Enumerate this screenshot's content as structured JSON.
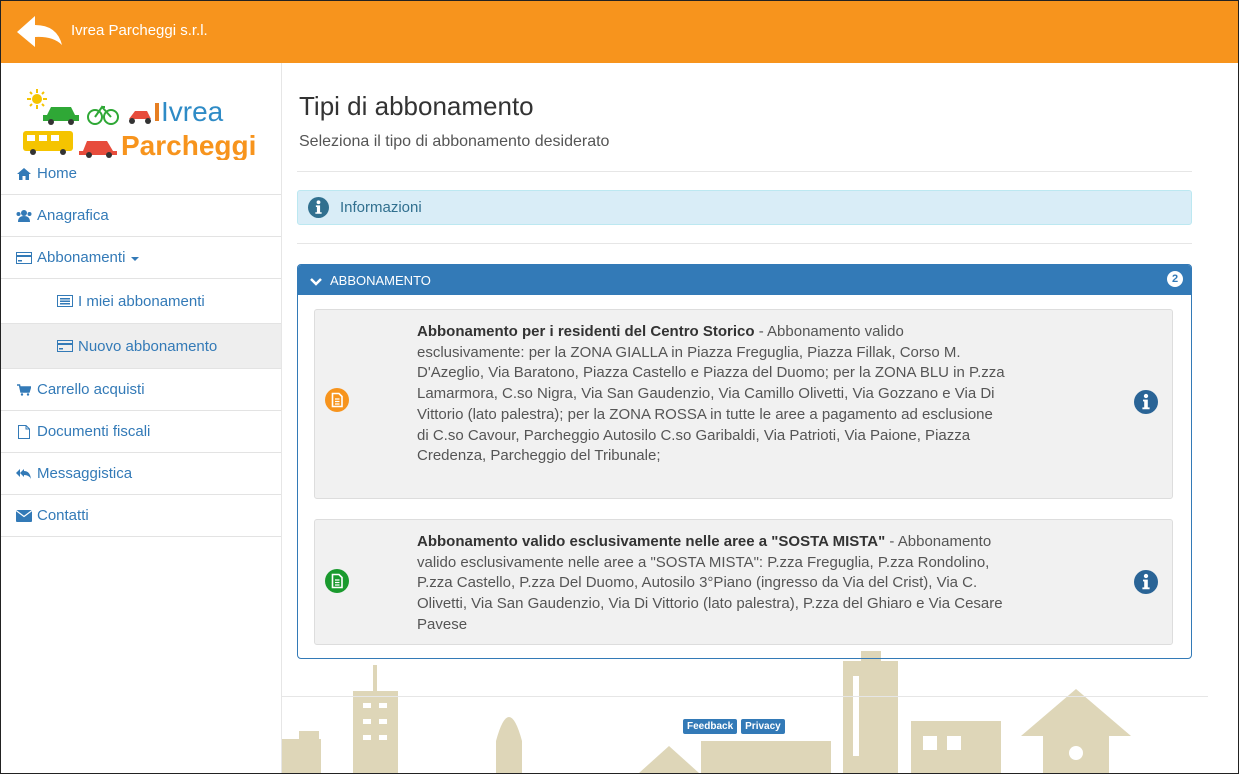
{
  "header": {
    "brand": "Ivrea Parcheggi s.r.l.",
    "back_icon": "back-arrow-icon"
  },
  "logo": {
    "line1": "Ivrea",
    "line2": "Parcheggi"
  },
  "sidebar": {
    "items": [
      {
        "label": "Home",
        "icon": "home-icon"
      },
      {
        "label": "Anagrafica",
        "icon": "users-icon"
      },
      {
        "label": "Abbonamenti",
        "icon": "card-icon"
      },
      {
        "label": "I miei abbonamenti",
        "icon": "list-icon"
      },
      {
        "label": "Nuovo abbonamento",
        "icon": "card-icon"
      },
      {
        "label": "Carrello acquisti",
        "icon": "cart-icon"
      },
      {
        "label": "Documenti fiscali",
        "icon": "document-icon"
      },
      {
        "label": "Messaggistica",
        "icon": "reply-all-icon"
      },
      {
        "label": "Contatti",
        "icon": "envelope-icon"
      }
    ]
  },
  "main": {
    "title": "Tipi di abbonamento",
    "subtitle": "Seleziona il tipo di abbonamento desiderato",
    "info_label": "Informazioni",
    "panel": {
      "title": "ABBONAMENTO",
      "count": "2",
      "cards": [
        {
          "title": "Abbonamento per i residenti del Centro Storico",
          "description": " - Abbonamento valido esclusivamente: per la ZONA GIALLA in Piazza Freguglia, Piazza Fillak, Corso M. D'Azeglio, Via Baratono, Piazza Castello e Piazza del Duomo; per la ZONA BLU in P.zza Lamarmora, C.so Nigra, Via San Gaudenzio, Via Camillo Olivetti, Via Gozzano e Via Di Vittorio (lato palestra); per la ZONA ROSSA in tutte le aree a pagamento ad esclusione di C.so Cavour, Parcheggio Autosilo C.so Garibaldi, Via Patrioti, Via Paione, Piazza Credenza, Parcheggio del Tribunale;",
          "icon_color": "#f7941d"
        },
        {
          "title": "Abbonamento valido esclusivamente nelle aree a \"SOSTA MISTA\"",
          "description": " - Abbonamento valido esclusivamente nelle aree a \"SOSTA MISTA\": P.zza Freguglia, P.zza Rondolino, P.zza Castello, P.zza Del Duomo, Autosilo 3°Piano (ingresso da Via del Crist), Via C. Olivetti, Via San Gaudenzio, Via Di Vittorio (lato palestra), P.zza del Ghiaro e Via Cesare Pavese",
          "icon_color": "#1a9a2e"
        }
      ]
    }
  },
  "footer": {
    "feedback": "Feedback",
    "privacy": "Privacy"
  },
  "colors": {
    "topbar": "#f7941d",
    "primary": "#337ab7",
    "info_bg": "#d9edf7",
    "skyline": "#ded6b8"
  }
}
